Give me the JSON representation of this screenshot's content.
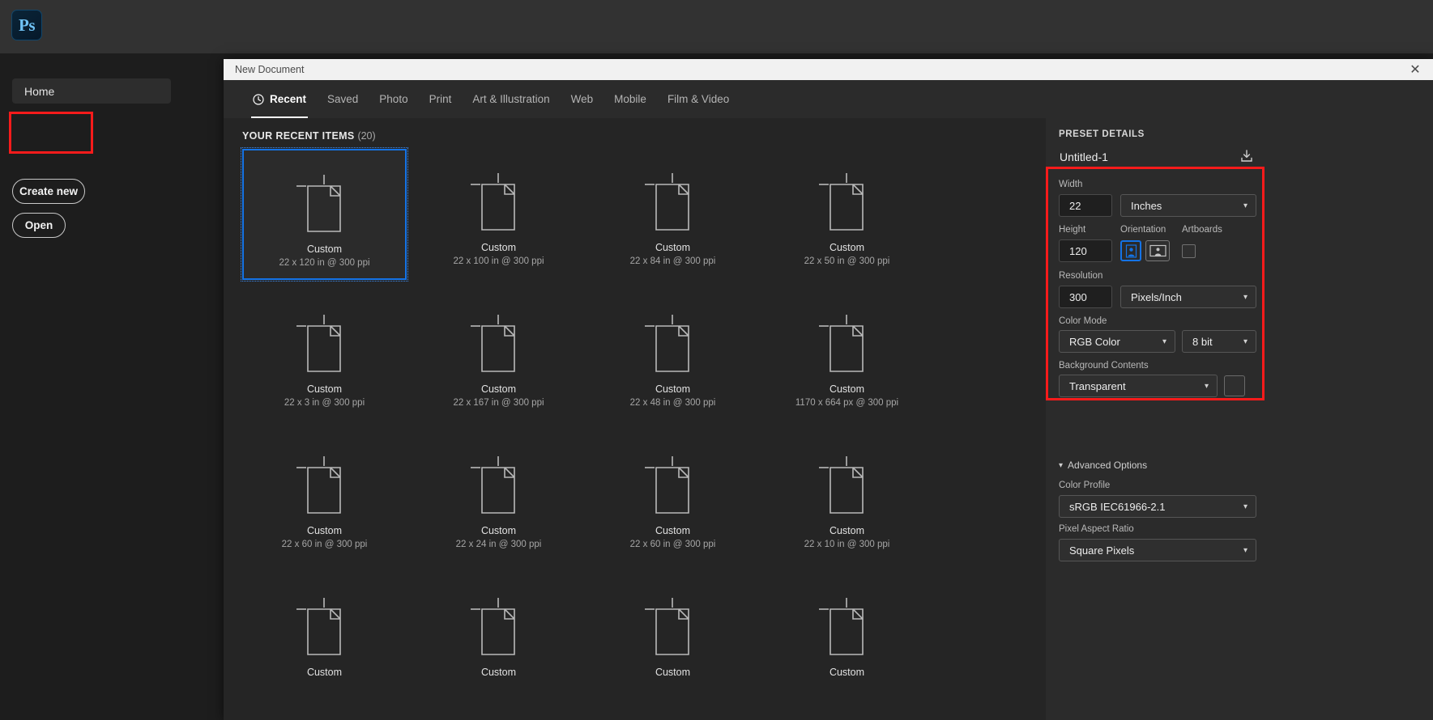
{
  "app": {
    "logo_label": "Ps",
    "logo_name": "photoshop-logo"
  },
  "left_rail": {
    "home_label": "Home",
    "create_new_label": "Create new",
    "open_label": "Open"
  },
  "modal": {
    "title": "New Document",
    "close_label": "✕",
    "tabs": [
      {
        "label": "Recent",
        "active": true,
        "icon": "clock-icon"
      },
      {
        "label": "Saved",
        "active": false
      },
      {
        "label": "Photo",
        "active": false
      },
      {
        "label": "Print",
        "active": false
      },
      {
        "label": "Art & Illustration",
        "active": false
      },
      {
        "label": "Web",
        "active": false
      },
      {
        "label": "Mobile",
        "active": false
      },
      {
        "label": "Film & Video",
        "active": false
      }
    ]
  },
  "recent": {
    "heading": "YOUR RECENT ITEMS",
    "count": "(20)",
    "items": [
      {
        "name": "Custom",
        "dims": "22 x 120 in @ 300 ppi",
        "selected": true
      },
      {
        "name": "Custom",
        "dims": "22 x 100 in @ 300 ppi",
        "selected": false
      },
      {
        "name": "Custom",
        "dims": "22 x 84 in @ 300 ppi",
        "selected": false
      },
      {
        "name": "Custom",
        "dims": "22 x 50 in @ 300 ppi",
        "selected": false
      },
      {
        "name": "Custom",
        "dims": "22 x 3 in @ 300 ppi",
        "selected": false
      },
      {
        "name": "Custom",
        "dims": "22 x 167 in @ 300 ppi",
        "selected": false
      },
      {
        "name": "Custom",
        "dims": "22 x 48 in @ 300 ppi",
        "selected": false
      },
      {
        "name": "Custom",
        "dims": "1170 x 664 px @ 300 ppi",
        "selected": false
      },
      {
        "name": "Custom",
        "dims": "22 x 60 in @ 300 ppi",
        "selected": false
      },
      {
        "name": "Custom",
        "dims": "22 x 24 in @ 300 ppi",
        "selected": false
      },
      {
        "name": "Custom",
        "dims": "22 x 60 in @ 300 ppi",
        "selected": false
      },
      {
        "name": "Custom",
        "dims": "22 x 10 in @ 300 ppi",
        "selected": false
      },
      {
        "name": "Custom",
        "dims": "",
        "selected": false
      },
      {
        "name": "Custom",
        "dims": "",
        "selected": false
      },
      {
        "name": "Custom",
        "dims": "",
        "selected": false
      },
      {
        "name": "Custom",
        "dims": "",
        "selected": false
      }
    ]
  },
  "preset": {
    "section_title": "PRESET DETAILS",
    "document_name": "Untitled-1",
    "save_preset_icon": "save-preset-icon",
    "width_label": "Width",
    "width_value": "22",
    "width_unit": "Inches",
    "height_label": "Height",
    "height_value": "120",
    "orientation_label": "Orientation",
    "orientation_selected": "portrait",
    "artboards_label": "Artboards",
    "artboards_checked": false,
    "resolution_label": "Resolution",
    "resolution_value": "300",
    "resolution_unit": "Pixels/Inch",
    "color_mode_label": "Color Mode",
    "color_mode_value": "RGB Color",
    "bit_depth_value": "8 bit",
    "background_label": "Background Contents",
    "background_value": "Transparent",
    "advanced_label": "Advanced Options",
    "color_profile_label": "Color Profile",
    "color_profile_value": "sRGB IEC61966-2.1",
    "pixel_aspect_label": "Pixel Aspect Ratio",
    "pixel_aspect_value": "Square Pixels"
  },
  "annotations": {
    "color": "#f81b1b",
    "boxes": [
      "create-new-button",
      "preset-details-fields"
    ]
  }
}
